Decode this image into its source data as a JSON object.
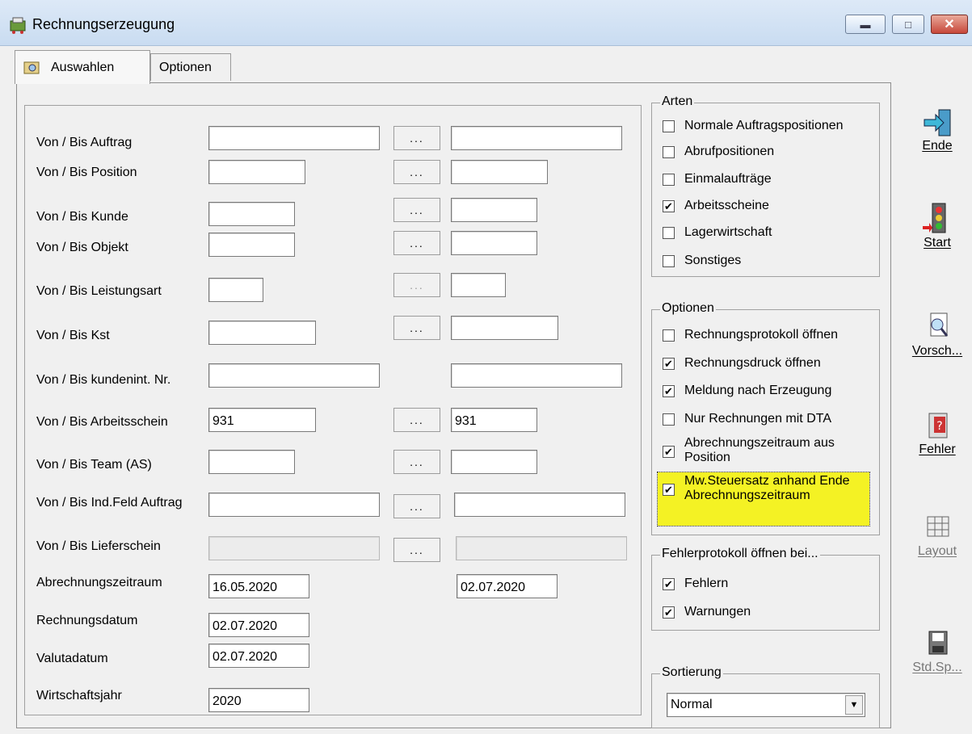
{
  "window": {
    "title": "Rechnungserzeugung"
  },
  "tabs": [
    {
      "label": "Auswahlen"
    },
    {
      "label": "Optionen"
    }
  ],
  "fields": [
    {
      "label": "Von / Bis Auftrag",
      "from": "",
      "to": ""
    },
    {
      "label": "Von / Bis Position",
      "from": "",
      "to": ""
    },
    {
      "label": "Von / Bis Kunde",
      "from": "",
      "to": ""
    },
    {
      "label": "Von / Bis Objekt",
      "from": "",
      "to": ""
    },
    {
      "label": "Von / Bis Leistungsart",
      "from": "",
      "to": ""
    },
    {
      "label": "Von / Bis Kst",
      "from": "",
      "to": ""
    },
    {
      "label": "Von / Bis kundenint. Nr.",
      "from": "",
      "to": ""
    },
    {
      "label": "Von / Bis Arbeitsschein",
      "from": "931",
      "to": "931"
    },
    {
      "label": "Von / Bis Team (AS)",
      "from": "",
      "to": ""
    },
    {
      "label": "Von / Bis Ind.Feld Auftrag",
      "from": "",
      "to": ""
    },
    {
      "label": "Von / Bis Lieferschein",
      "from": "",
      "to": ""
    }
  ],
  "browse_label": "...",
  "dates": {
    "abrechnung": {
      "label": "Abrechnungszeitraum",
      "from": "16.05.2020",
      "to": "02.07.2020"
    },
    "rechnungsdatum": {
      "label": "Rechnungsdatum",
      "value": "02.07.2020"
    },
    "valutadatum": {
      "label": "Valutadatum",
      "value": "02.07.2020"
    },
    "wirtschaftsjahr": {
      "label": "Wirtschaftsjahr",
      "value": "2020"
    }
  },
  "arten": {
    "title": "Arten",
    "items": [
      {
        "label": "Normale Auftragspositionen",
        "checked": false
      },
      {
        "label": "Abrufpositionen",
        "checked": false
      },
      {
        "label": "Einmalaufträge",
        "checked": false
      },
      {
        "label": "Arbeitsscheine",
        "checked": true
      },
      {
        "label": "Lagerwirtschaft",
        "checked": false
      },
      {
        "label": "Sonstiges",
        "checked": false
      }
    ]
  },
  "optionen": {
    "title": "Optionen",
    "items": [
      {
        "label": "Rechnungsprotokoll öffnen",
        "checked": false
      },
      {
        "label": "Rechnungsdruck öffnen",
        "checked": true
      },
      {
        "label": "Meldung nach Erzeugung",
        "checked": true
      },
      {
        "label": "Nur Rechnungen mit DTA",
        "checked": false
      },
      {
        "label": "Abrechnungszeitraum aus",
        "label2": "Position",
        "checked": true
      },
      {
        "label": "Mw.Steuersatz anhand Ende",
        "label2": "Abrechnungszeitraum",
        "checked": true
      }
    ]
  },
  "fehlerprotokoll": {
    "title": "Fehlerprotokoll öffnen bei...",
    "items": [
      {
        "label": "Fehlern",
        "checked": true
      },
      {
        "label": "Warnungen",
        "checked": true
      }
    ]
  },
  "sortierung": {
    "title": "Sortierung",
    "value": "Normal"
  },
  "right_buttons": [
    {
      "label": "Ende",
      "icon": "exit-door-icon"
    },
    {
      "label": "Start",
      "icon": "traffic-light-icon"
    },
    {
      "label": "Vorsch...",
      "icon": "preview-icon"
    },
    {
      "label": "Fehler",
      "icon": "error-icon"
    },
    {
      "label": "Layout",
      "icon": "layout-icon"
    },
    {
      "label": "Std.Sp...",
      "icon": "save-standard-icon"
    }
  ],
  "colors": {
    "highlight": "#f4f224",
    "titlebar": "#c9dcf1",
    "check": "#000000"
  }
}
